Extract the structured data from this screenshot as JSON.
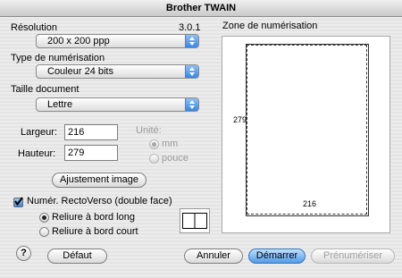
{
  "window": {
    "title": "Brother TWAIN"
  },
  "resolution": {
    "label": "Résolution",
    "version": "3.0.1",
    "value": "200 x 200 ppp"
  },
  "scan_type": {
    "label": "Type de numérisation",
    "value": "Couleur 24 bits"
  },
  "doc_size": {
    "label": "Taille document",
    "value": "Lettre"
  },
  "dimensions": {
    "width_label": "Largeur:",
    "width_value": "216",
    "height_label": "Hauteur:",
    "height_value": "279",
    "unit_label": "Unité:",
    "unit_mm": "mm",
    "unit_inch": "pouce"
  },
  "adjust_button": "Ajustement image",
  "duplex": {
    "label": "Numér. RectoVerso (double face)",
    "checked": true,
    "long_edge": "Reliure à bord long",
    "short_edge": "Reliure à bord court"
  },
  "scan_area": {
    "title": "Zone de numérisation",
    "width_value": "216",
    "height_value": "279"
  },
  "buttons": {
    "help": "?",
    "default": "Défaut",
    "cancel": "Annuler",
    "start": "Démarrer",
    "prescan": "Prénumériser"
  },
  "colors": {
    "accent": "#3b86e0",
    "default_button": "#4f9be9"
  },
  "icons": {
    "help": "question-mark-icon",
    "select_arrow": "updown-arrows-icon",
    "duplex_preview": "book-binding-icon"
  }
}
